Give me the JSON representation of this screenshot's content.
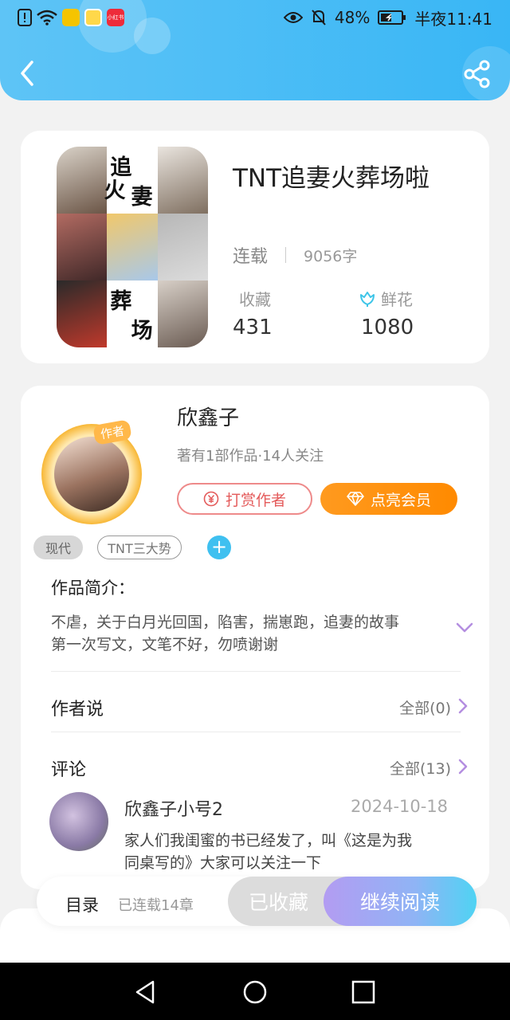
{
  "status_bar": {
    "battery": "48%",
    "time": "半夜11:41",
    "app_badge_3": "小红书"
  },
  "book": {
    "title": "TNT追妻火葬场啦",
    "status": "连载",
    "word_count": "9056字",
    "cover_chars": [
      "追",
      "妻",
      "火",
      "葬",
      "场"
    ],
    "favorites_label": "收藏",
    "favorites_value": "431",
    "flowers_label": "鲜花",
    "flowers_value": "1080"
  },
  "author": {
    "avatar_tag": "作者",
    "name": "欣鑫子",
    "meta": "著有1部作品·14人关注",
    "tip_button": "打赏作者",
    "vip_button": "点亮会员",
    "tags": [
      "现代",
      "TNT三大势"
    ]
  },
  "intro": {
    "title": "作品简介：",
    "lines": [
      "不虐，关于白月光回国，陷害，揣崽跑，追妻的故事",
      "第一次写文，文笔不好，勿喷谢谢"
    ]
  },
  "author_says": {
    "title": "作者说",
    "all": "全部(0)"
  },
  "comments": {
    "title": "评论",
    "all": "全部(13)",
    "items": [
      {
        "user": "欣鑫子小号2",
        "date": "2024-10-18",
        "text_lines": [
          "家人们我闺蜜的书已经发了，叫《这是为我",
          "同桌写的》大家可以关注一下"
        ]
      }
    ]
  },
  "bottom_bar": {
    "toc_label": "目录",
    "toc_count": "已连载14章",
    "fav_button": "已收藏",
    "read_button": "继续阅读"
  },
  "colors": {
    "header": "#39b6f5",
    "vip": "#ff8a00",
    "tip": "#e45b5b",
    "read_gradient_start": "#b39cf2",
    "read_gradient_end": "#4fd3f3"
  }
}
